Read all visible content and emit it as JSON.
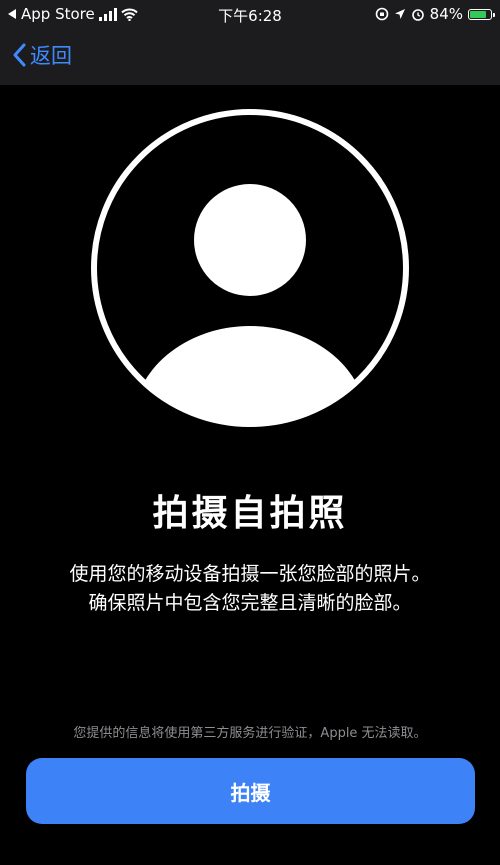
{
  "status_bar": {
    "back_app": "App Store",
    "time": "下午6:28",
    "battery_percent": "84%",
    "battery_level": 0.84
  },
  "nav": {
    "back_label": "返回"
  },
  "main": {
    "title": "拍摄自拍照",
    "description_line1": "使用您的移动设备拍摄一张您脸部的照片。",
    "description_line2": "确保照片中包含您完整且清晰的脸部。",
    "disclaimer": "您提供的信息将使用第三方服务进行验证，Apple 无法读取。",
    "capture_button_label": "拍摄"
  },
  "colors": {
    "accent": "#3d82f6",
    "battery_green": "#34c759"
  }
}
